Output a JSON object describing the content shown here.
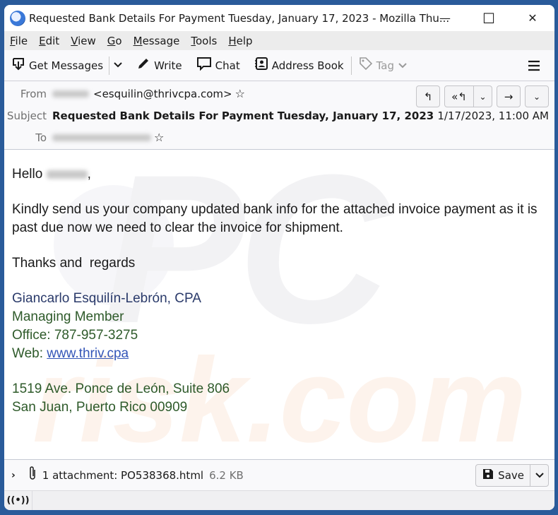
{
  "window": {
    "title": "Requested Bank Details For Payment Tuesday, January 17, 2023 - Mozilla Thu...",
    "controls": {
      "minimize": "—",
      "maximize": "☐",
      "close": "✕"
    }
  },
  "menubar": [
    {
      "accel": "F",
      "rest": "ile"
    },
    {
      "accel": "E",
      "rest": "dit"
    },
    {
      "accel": "V",
      "rest": "iew"
    },
    {
      "accel": "G",
      "rest": "o"
    },
    {
      "accel": "M",
      "rest": "essage"
    },
    {
      "accel": "T",
      "rest": "ools"
    },
    {
      "accel": "H",
      "rest": "elp"
    }
  ],
  "toolbar": {
    "get_messages": "Get Messages",
    "write": "Write",
    "chat": "Chat",
    "address_book": "Address Book",
    "tag": "Tag"
  },
  "header": {
    "from_label": "From",
    "from_email": "<esquilin@thrivcpa.com>",
    "subject_label": "Subject",
    "subject": "Requested Bank Details For Payment Tuesday, January 17, 2023",
    "to_label": "To",
    "date": "1/17/2023, 11:00 AM"
  },
  "body": {
    "greeting": "Hello",
    "greeting_suffix": ",",
    "paragraph": "Kindly send us your company updated bank info for the attached invoice payment as it is past due now we need to clear the invoice for shipment.",
    "closing": "Thanks and  regards",
    "signature": {
      "name": "Giancarlo Esquilín-Lebrón, CPA",
      "title": "Managing Member",
      "office": "Office: 787-957-3275",
      "web_label": "Web: ",
      "web_link": "www.thriv.cpa",
      "address1": "1519 Ave. Ponce de León, Suite 806",
      "address2": "San Juan, Puerto Rico 00909"
    },
    "watermark": {
      "top": "PC",
      "bottom": "risk.com"
    }
  },
  "attachment": {
    "text": "1 attachment: PO538368.html",
    "size": "6.2 KB",
    "save_label": "Save"
  }
}
